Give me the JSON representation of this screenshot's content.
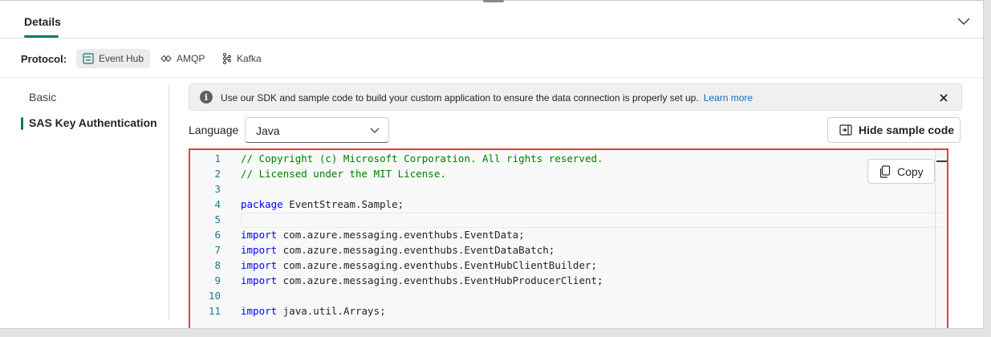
{
  "header": {
    "tab_details": "Details"
  },
  "protocol": {
    "label": "Protocol:",
    "options": [
      {
        "label": "Event Hub",
        "icon": "event-hub-icon",
        "selected": true
      },
      {
        "label": "AMQP",
        "icon": "amqp-icon",
        "selected": false
      },
      {
        "label": "Kafka",
        "icon": "kafka-icon",
        "selected": false
      }
    ]
  },
  "nav": {
    "items": [
      {
        "label": "Basic",
        "selected": false
      },
      {
        "label": "SAS Key Authentication",
        "selected": true
      }
    ]
  },
  "banner": {
    "text": "Use our SDK and sample code to build your custom application to ensure the data connection is properly set up.",
    "link": "Learn more"
  },
  "language": {
    "label": "Language",
    "value": "Java"
  },
  "actions": {
    "hide_sample_code": "Hide sample code",
    "copy": "Copy"
  },
  "code": {
    "lines": [
      {
        "n": "1",
        "type": "comment",
        "text": "// Copyright (c) Microsoft Corporation. All rights reserved."
      },
      {
        "n": "2",
        "type": "comment",
        "text": "// Licensed under the MIT License."
      },
      {
        "n": "3",
        "type": "blank",
        "text": ""
      },
      {
        "n": "4",
        "type": "code",
        "kw": "package",
        "text": " EventStream.Sample;"
      },
      {
        "n": "5",
        "type": "blank",
        "text": ""
      },
      {
        "n": "6",
        "type": "code",
        "kw": "import",
        "text": " com.azure.messaging.eventhubs.EventData;"
      },
      {
        "n": "7",
        "type": "code",
        "kw": "import",
        "text": " com.azure.messaging.eventhubs.EventDataBatch;"
      },
      {
        "n": "8",
        "type": "code",
        "kw": "import",
        "text": " com.azure.messaging.eventhubs.EventHubClientBuilder;"
      },
      {
        "n": "9",
        "type": "code",
        "kw": "import",
        "text": " com.azure.messaging.eventhubs.EventHubProducerClient;"
      },
      {
        "n": "10",
        "type": "blank",
        "text": ""
      },
      {
        "n": "11",
        "type": "code",
        "kw": "import",
        "text": " java.util.Arrays;"
      }
    ]
  },
  "colors": {
    "accent": "#117865",
    "link": "#0f6cbd",
    "highlight_border": "#e04040",
    "code_comment": "#008000",
    "code_keyword": "#0000ff",
    "line_number": "#237893"
  }
}
